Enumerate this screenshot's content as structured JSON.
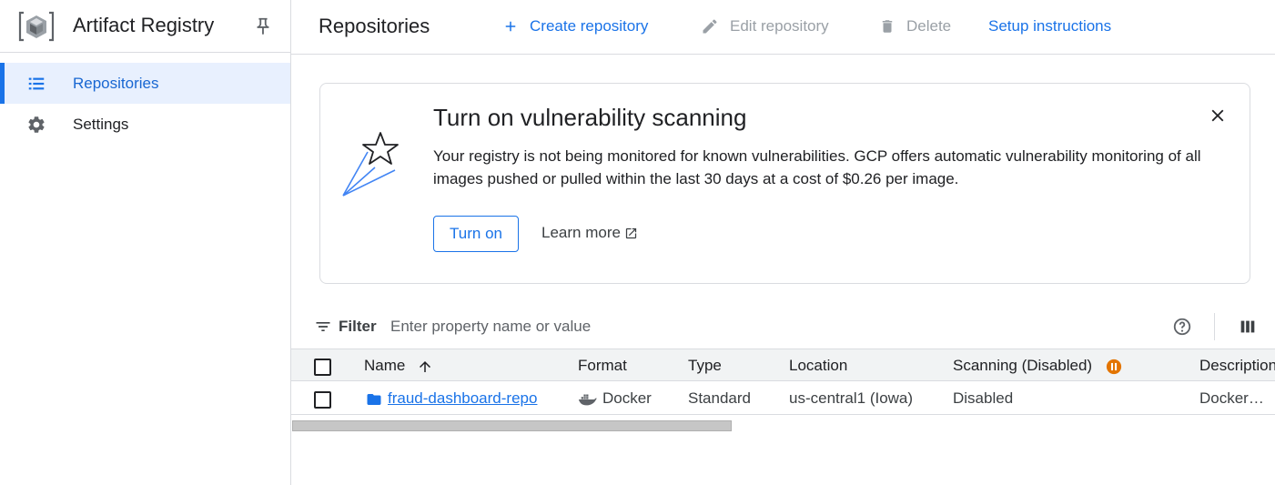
{
  "sidebar": {
    "product_title": "Artifact Registry",
    "product_icon": "artifact-registry-logo",
    "items": [
      {
        "label": "Repositories",
        "icon": "list-icon",
        "active": true
      },
      {
        "label": "Settings",
        "icon": "gear-icon",
        "active": false
      }
    ]
  },
  "header": {
    "page_title": "Repositories",
    "actions": {
      "create": "Create repository",
      "edit": "Edit repository",
      "delete": "Delete",
      "setup": "Setup instructions"
    }
  },
  "banner": {
    "title": "Turn on vulnerability scanning",
    "text": "Your registry is not being monitored for known vulnerabilities. GCP offers automatic vulnerability monitoring of all images pushed or pulled within the last 30 days at a cost of $0.26 per image.",
    "primary_button": "Turn on",
    "secondary_link": "Learn more"
  },
  "filter": {
    "label": "Filter",
    "placeholder": "Enter property name or value"
  },
  "table": {
    "columns": [
      "Name",
      "Format",
      "Type",
      "Location",
      "Scanning (Disabled)",
      "Description"
    ],
    "rows": [
      {
        "name": "fraud-dashboard-repo",
        "format": "Docker",
        "type": "Standard",
        "location": "us-central1 (Iowa)",
        "scanning": "Disabled",
        "description": "Docker…"
      }
    ]
  },
  "colors": {
    "accent": "#1a73e8",
    "active_bg": "#e8f0fe",
    "scan_badge": "#e37400",
    "border": "#dadce0"
  }
}
